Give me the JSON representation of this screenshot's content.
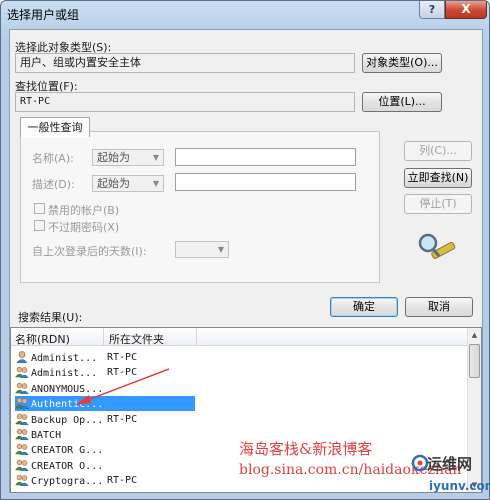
{
  "window": {
    "title": "选择用户或组",
    "help_glyph": "?",
    "close_glyph": "X"
  },
  "object_type": {
    "label": "选择此对象类型(S):",
    "value": "用户、组或内置安全主体",
    "button": "对象类型(O)..."
  },
  "location": {
    "label": "查找位置(F):",
    "value": "RT-PC",
    "button": "位置(L)..."
  },
  "query": {
    "tab": "一般性查询",
    "name_label": "名称(A):",
    "name_combo": "起始为",
    "desc_label": "描述(D):",
    "desc_combo": "起始为",
    "disabled_accounts": "禁用的帐户(B)",
    "no_expire_pwd": "不过期密码(X)",
    "days_since_logon": "自上次登录后的天数(I):"
  },
  "side_buttons": {
    "columns": "列(C)...",
    "find_now": "立即查找(N)",
    "stop": "停止(T)"
  },
  "ok": "确定",
  "cancel": "取消",
  "results": {
    "label": "搜索结果(U):",
    "columns": [
      "名称(RDN)",
      "所在文件夹"
    ],
    "rows": [
      {
        "name": "Administ...",
        "folder": "RT-PC",
        "icon": "user-icon",
        "selected": false
      },
      {
        "name": "Administ...",
        "folder": "RT-PC",
        "icon": "group-icon",
        "selected": false
      },
      {
        "name": "ANONYMOUS...",
        "folder": "",
        "icon": "group-icon",
        "selected": false
      },
      {
        "name": "Authentic...",
        "folder": "",
        "icon": "group-icon",
        "selected": true
      },
      {
        "name": "Backup Op...",
        "folder": "RT-PC",
        "icon": "group-icon",
        "selected": false
      },
      {
        "name": "BATCH",
        "folder": "",
        "icon": "group-icon",
        "selected": false
      },
      {
        "name": "CREATOR G...",
        "folder": "",
        "icon": "group-icon",
        "selected": false
      },
      {
        "name": "CREATOR O...",
        "folder": "",
        "icon": "group-icon",
        "selected": false
      },
      {
        "name": "Cryptogra...",
        "folder": "RT-PC",
        "icon": "group-icon",
        "selected": false
      }
    ]
  },
  "watermark": {
    "line1": "海岛客栈&新浪博客",
    "line2": "blog.sina.com.cn/haidaokezhan",
    "logo_text": "运维网",
    "logo_url": "iyunv.com"
  },
  "colors": {
    "selection": "#3399ff",
    "watermark": "#e0403f",
    "arrow": "#e0403f"
  }
}
